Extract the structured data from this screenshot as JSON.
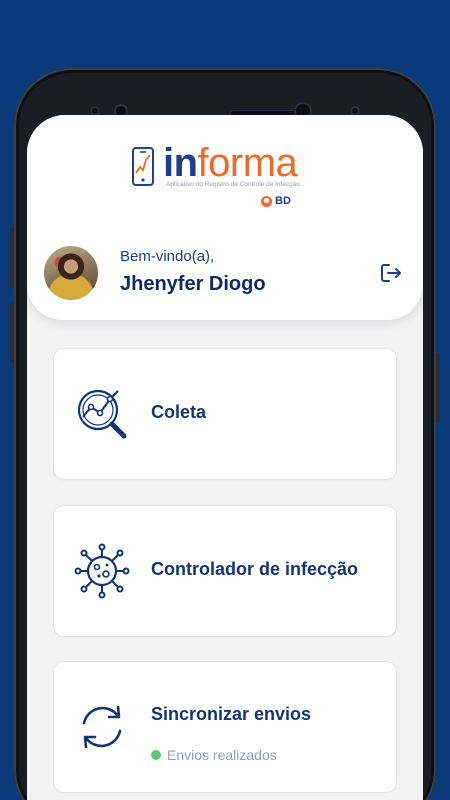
{
  "header": {
    "logo": {
      "word_in": "in",
      "word_forma": "forma",
      "subtitle": "Aplicativo do Registro de Controle de Infecção",
      "brand": "BD"
    },
    "greeting": "Bem-vindo(a),",
    "user_name": "Jhenyfer Diogo"
  },
  "menu": {
    "items": [
      {
        "label": "Coleta",
        "icon": "search-chart-icon"
      },
      {
        "label": "Controlador de infecção",
        "icon": "virus-icon"
      },
      {
        "label": "Sincronizar envios",
        "icon": "sync-icon",
        "status": "Envios realizados",
        "status_color": "#5bc776"
      }
    ]
  },
  "colors": {
    "background": "#0c3a7a",
    "primary": "#123573",
    "accent": "#f06a25"
  }
}
